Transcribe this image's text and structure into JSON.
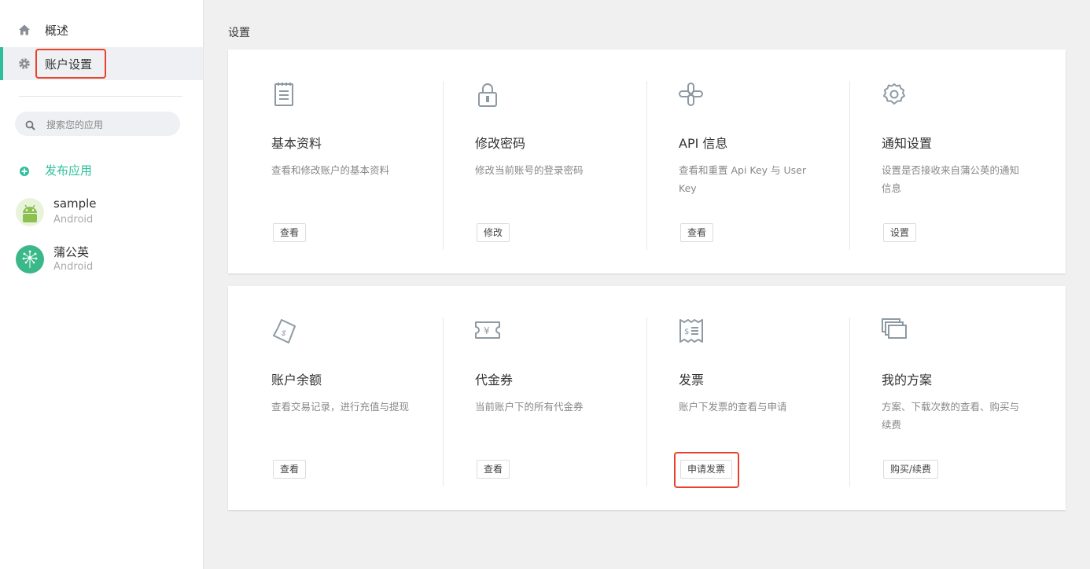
{
  "sidebar": {
    "nav": [
      {
        "label": "概述",
        "icon": "home-icon"
      },
      {
        "label": "账户设置",
        "icon": "gear-icon",
        "active": true
      }
    ],
    "search": {
      "placeholder": "搜索您的应用",
      "icon": "search-icon"
    },
    "publish_label": "发布应用",
    "apps": [
      {
        "name": "sample",
        "platform": "Android",
        "icon": "android-icon"
      },
      {
        "name": "蒲公英",
        "platform": "Android",
        "icon": "dandelion-icon"
      }
    ]
  },
  "page": {
    "title": "设置"
  },
  "cards": [
    {
      "items": [
        {
          "icon": "document-icon",
          "title": "基本资料",
          "desc": "查看和修改账户的基本资料",
          "button": "查看"
        },
        {
          "icon": "lock-icon",
          "title": "修改密码",
          "desc": "修改当前账号的登录密码",
          "button": "修改"
        },
        {
          "icon": "api-link-icon",
          "title": "API 信息",
          "desc": "查看和重置 Api Key 与 User Key",
          "button": "查看"
        },
        {
          "icon": "gear-icon",
          "title": "通知设置",
          "desc": "设置是否接收来自蒲公英的通知信息",
          "button": "设置"
        }
      ]
    },
    {
      "items": [
        {
          "icon": "money-note-icon",
          "title": "账户余额",
          "desc": "查看交易记录，进行充值与提现",
          "button": "查看"
        },
        {
          "icon": "yen-ticket-icon",
          "title": "代金券",
          "desc": "当前账户下的所有代金券",
          "button": "查看"
        },
        {
          "icon": "receipt-icon",
          "title": "发票",
          "desc": "账户下发票的查看与申请",
          "button": "申请发票"
        },
        {
          "icon": "stacked-windows-icon",
          "title": "我的方案",
          "desc": "方案、下载次数的查看、购买与续费",
          "button": "购买/续费"
        }
      ]
    }
  ],
  "colors": {
    "accent": "#2cc09a",
    "highlight": "#e8412c",
    "icon": "#8e9aa3"
  }
}
